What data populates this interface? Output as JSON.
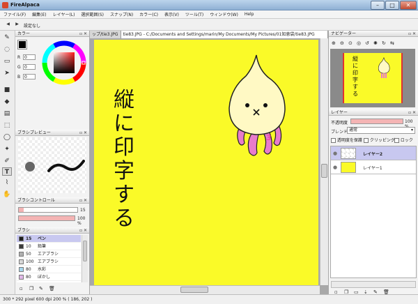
{
  "window": {
    "title": "FireAlpaca"
  },
  "menu": [
    "ファイル(F)",
    "編集(E)",
    "レイヤー(L)",
    "選択範囲(S)",
    "スナップ(N)",
    "カラー(C)",
    "表示(V)",
    "ツール(T)",
    "ウィンドウ(W)",
    "Help"
  ],
  "toolbar": {
    "prev_label": "◀",
    "next_label": "▶",
    "setting_label": "設定なし"
  },
  "color_panel": {
    "title": "カラー",
    "r_label": "R",
    "g_label": "G",
    "b_label": "B",
    "r": "0",
    "g": "0",
    "b": "0"
  },
  "brush_preview": {
    "title": "ブラシプレビュー"
  },
  "brush_control": {
    "title": "ブラシコントロール",
    "size": "15",
    "opacity": "100 %",
    "size_fraction": 0.08,
    "opacity_fraction": 1.0
  },
  "brush_list": {
    "title": "ブラシ",
    "items": [
      {
        "size": "15",
        "name": "ペン",
        "color": "#1e1e1e",
        "selected": true
      },
      {
        "size": "10",
        "name": "鉛筆",
        "color": "#3a3a3a",
        "selected": false
      },
      {
        "size": "50",
        "name": "エアブラシ",
        "color": "#b0b0b0",
        "selected": false
      },
      {
        "size": "100",
        "name": "エアブラシ",
        "color": "#d8d8d8",
        "selected": false
      },
      {
        "size": "80",
        "name": "水彩",
        "color": "#a8d8ee",
        "selected": false
      },
      {
        "size": "80",
        "name": "ぼかし",
        "color": "#e0b8e8",
        "selected": false
      }
    ]
  },
  "tabs": [
    {
      "label": "ップ/tie3.JPG",
      "active": false
    },
    {
      "label": "tie83.JPG - C:/Documents and Settings/marin/My Documents/My Pictures/01知恵袋/tie83.JPG",
      "active": true
    }
  ],
  "canvas": {
    "text_chars": [
      "縦",
      "に",
      "印",
      "字",
      "す",
      "る"
    ],
    "background": "#fafa28",
    "mascot_mark": "3"
  },
  "navigator": {
    "title": "ナビゲーター"
  },
  "layers": {
    "title": "レイヤー",
    "opacity_label": "不透明度",
    "opacity_value": "100 %",
    "blend_label": "ブレンド",
    "blend_value": "通常",
    "protect_label": "透明度を保護",
    "clipping_label": "クリッピング",
    "lock_label": "ロック",
    "items": [
      {
        "name": "レイヤー2",
        "selected": true
      },
      {
        "name": "レイヤー1",
        "selected": false
      }
    ]
  },
  "status": {
    "text": "300 * 292 pixel   600 dpi   200 %   ( 186, 202 )"
  },
  "colors": {
    "accent": "#c8c8f0",
    "canvas": "#fafa28",
    "brush_bar": "#f4b4b4"
  }
}
